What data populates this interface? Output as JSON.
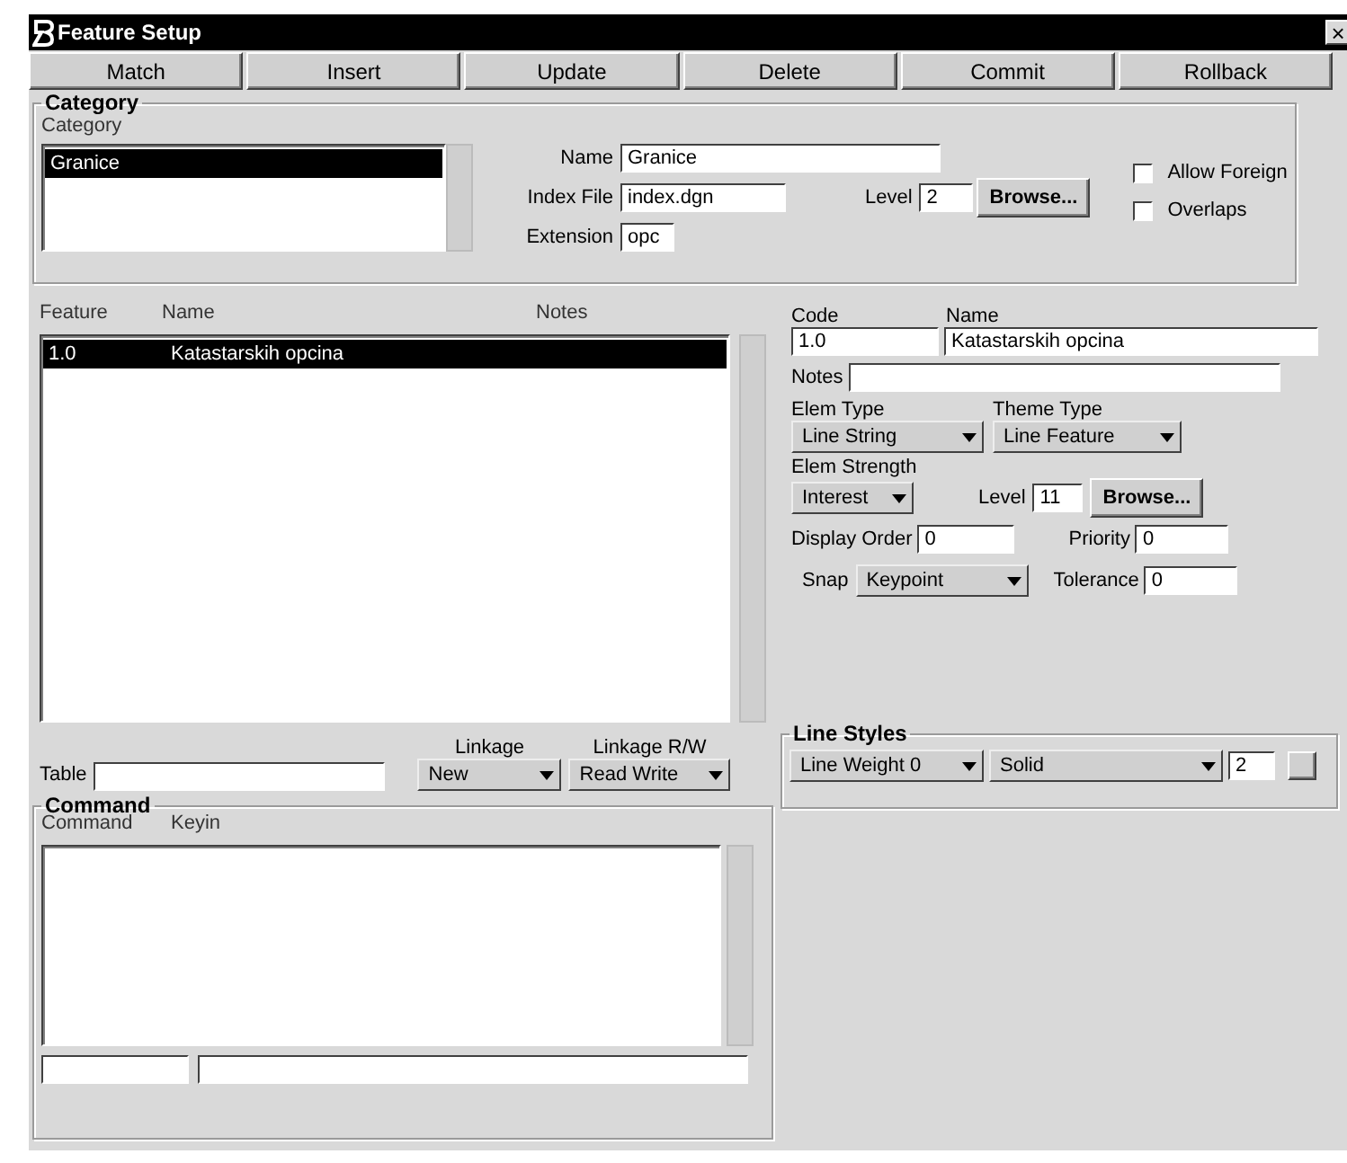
{
  "window": {
    "title": "Feature Setup",
    "close": "×"
  },
  "toolbar": [
    {
      "label": "Match"
    },
    {
      "label": "Insert"
    },
    {
      "label": "Update"
    },
    {
      "label": "Delete"
    },
    {
      "label": "Commit"
    },
    {
      "label": "Rollback"
    }
  ],
  "category": {
    "title": "Category",
    "list_header": "Category",
    "items": [
      {
        "label": "Granice",
        "selected": true
      }
    ],
    "name": {
      "label": "Name",
      "value": "Granice"
    },
    "index_file": {
      "label": "Index File",
      "value": "index.dgn"
    },
    "level": {
      "label": "Level",
      "value": "2"
    },
    "browse": "Browse...",
    "extension": {
      "label": "Extension",
      "value": "opc"
    },
    "checks": [
      {
        "label": "Allow Foreign",
        "checked": false
      },
      {
        "label": "Overlaps",
        "checked": false
      }
    ]
  },
  "features": {
    "columns": [
      "Feature",
      "Name",
      "Notes"
    ],
    "rows": [
      {
        "cells": [
          "1.0",
          "Katastarskih opcina"
        ],
        "selected": true
      }
    ]
  },
  "detail": {
    "code": {
      "label": "Code",
      "value": "1.0"
    },
    "name": {
      "label": "Name",
      "value": "Katastarskih opcina"
    },
    "notes": {
      "label": "Notes"
    },
    "elem_type": {
      "label": "Elem Type",
      "value": "Line String"
    },
    "theme_type": {
      "label": "Theme Type",
      "value": "Line Feature"
    },
    "elem_strength": {
      "label": "Elem Strength",
      "value": "Interest"
    },
    "level": {
      "label": "Level",
      "value": "11"
    },
    "browse": "Browse...",
    "display_order": {
      "label": "Display Order",
      "value": "0"
    },
    "priority": {
      "label": "Priority",
      "value": "0"
    },
    "snap": {
      "label": "Snap",
      "value": "Keypoint"
    },
    "tolerance": {
      "label": "Tolerance",
      "value": "0"
    }
  },
  "table": {
    "label": "Table"
  },
  "linkage": {
    "label": "Linkage",
    "value": "New"
  },
  "linkage_rw": {
    "label": "Linkage R/W",
    "value": "Read Write"
  },
  "line_styles": {
    "title": "Line Styles",
    "weight": "Line Weight 0",
    "style": "Solid",
    "value": "2"
  },
  "command": {
    "title": "Command",
    "columns": [
      "Command",
      "Keyin"
    ]
  }
}
